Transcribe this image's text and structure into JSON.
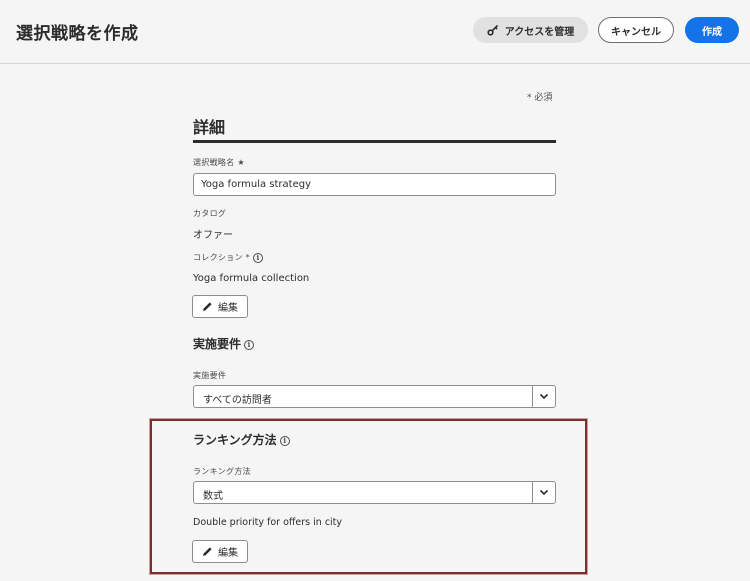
{
  "header": {
    "title": "選択戦略を作成",
    "access_label": "アクセスを管理",
    "cancel_label": "キャンセル",
    "create_label": "作成"
  },
  "form": {
    "required_note": "* 必須",
    "details_title": "詳細",
    "name_label": "選択戦略名 ★",
    "name_value": "Yoga formula strategy",
    "catalog_label": "カタログ",
    "catalog_value": "オファー",
    "collection_label": "コレクション *",
    "collection_value": "Yoga formula collection",
    "edit_label": "編集",
    "eligibility_title": "実施要件",
    "eligibility_label": "実施要件",
    "eligibility_value": "すべての訪問者",
    "ranking_title": "ランキング方法",
    "ranking_label": "ランキング方法",
    "ranking_value": "数式",
    "formula_name": "Double priority for offers in city",
    "ranking_edit_label": "編集"
  },
  "icons": {
    "key": "key-icon",
    "info": "info-icon",
    "pencil": "pencil-icon",
    "chevron": "chevron-down-icon"
  },
  "colors": {
    "primary": "#1473e6",
    "highlight_border": "#7a2e2e"
  }
}
